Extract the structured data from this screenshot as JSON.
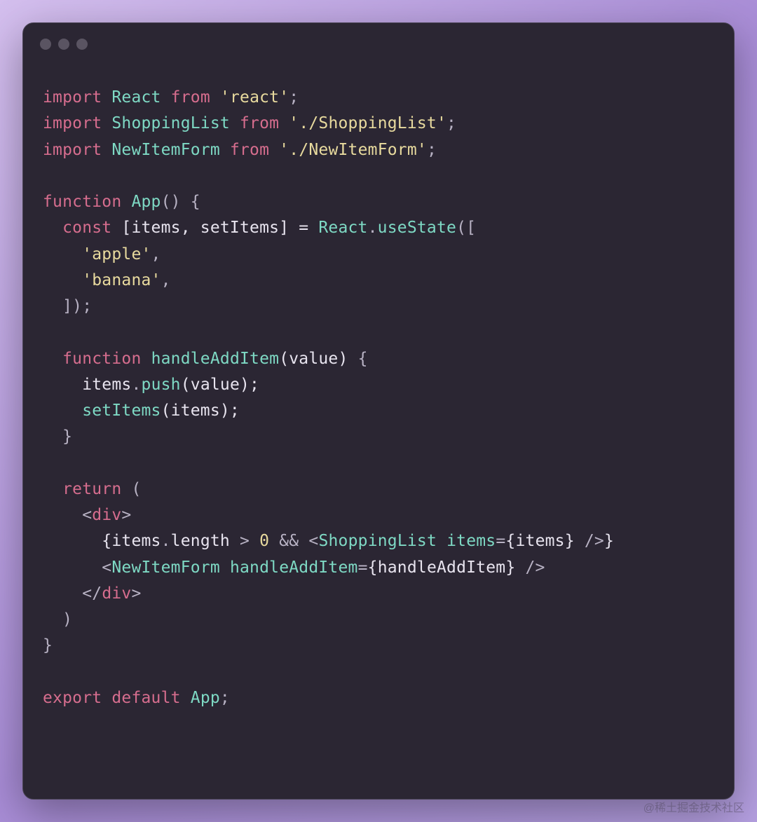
{
  "watermark": "@稀土掘金技术社区",
  "code": {
    "line1": {
      "kw1": "import",
      "cls": "React",
      "kw2": "from",
      "str": "'react'",
      "end": ";"
    },
    "line2": {
      "kw1": "import",
      "cls": "ShoppingList",
      "kw2": "from",
      "str": "'./ShoppingList'",
      "end": ";"
    },
    "line3": {
      "kw1": "import",
      "cls": "NewItemForm",
      "kw2": "from",
      "str": "'./NewItemForm'",
      "end": ";"
    },
    "line5": {
      "kw": "function",
      "name": "App",
      "paren": "()",
      "brace": " {"
    },
    "line6": {
      "indent": "  ",
      "kw": "const",
      "destr": " [items, setItems] = ",
      "cls": "React",
      "dot": ".",
      "fn": "useState",
      "open": "(["
    },
    "line7": {
      "indent": "    ",
      "str": "'apple'",
      "comma": ","
    },
    "line8": {
      "indent": "    ",
      "str": "'banana'",
      "comma": ","
    },
    "line9": {
      "indent": "  ",
      "close": "]);"
    },
    "line11": {
      "indent": "  ",
      "kw": "function",
      "sp": " ",
      "name": "handleAddItem",
      "args": "(value)",
      "brace": " {"
    },
    "line12": {
      "indent": "    ",
      "obj": "items",
      "dot": ".",
      "fn": "push",
      "args": "(value);"
    },
    "line13": {
      "indent": "    ",
      "fn": "setItems",
      "args": "(items);"
    },
    "line14": {
      "indent": "  ",
      "close": "}"
    },
    "line16": {
      "indent": "  ",
      "kw": "return",
      "open": " ("
    },
    "line17": {
      "indent": "    ",
      "a1": "<",
      "tag": "div",
      "a2": ">"
    },
    "line18": {
      "indent": "      ",
      "open": "{",
      "expr1": "items",
      "dot": ".",
      "prop": "length",
      "op1": " > ",
      "num": "0",
      "op2": " && ",
      "a1": "<",
      "tag": "ShoppingList",
      "sp": " ",
      "attr": "items",
      "eq": "=",
      "bra": "{",
      "val": "items",
      "ket": "}",
      "close": " />",
      "end": "}"
    },
    "line19": {
      "indent": "      ",
      "a1": "<",
      "tag": "NewItemForm",
      "sp": " ",
      "attr": "handleAddItem",
      "eq": "=",
      "bra": "{",
      "val": "handleAddItem",
      "ket": "}",
      "close": " />"
    },
    "line20": {
      "indent": "    ",
      "a1": "</",
      "tag": "div",
      "a2": ">"
    },
    "line21": {
      "indent": "  ",
      "close": ")"
    },
    "line22": {
      "close": "}"
    },
    "line24": {
      "kw1": "export",
      "kw2": "default",
      "name": "App",
      "end": ";"
    }
  }
}
